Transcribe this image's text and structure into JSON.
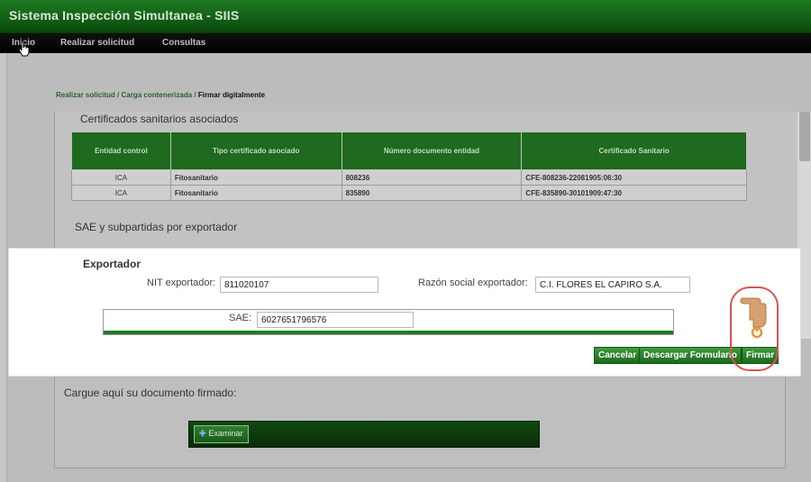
{
  "app": {
    "title": "Sistema Inspección Simultanea - SIIS"
  },
  "menu": {
    "items": [
      {
        "label": "Inicio"
      },
      {
        "label": "Realizar solicitud"
      },
      {
        "label": "Consultas"
      }
    ]
  },
  "breadcrumb": {
    "path": "Realizar solicitud / Carga contenerizada / ",
    "current": "Firmar digitalmente"
  },
  "certificates": {
    "section_title": "Certificados sanitarios asociados",
    "columns": [
      "Entidad control",
      "Tipo certificado asociado",
      "Número documento entidad",
      "Certificado Sanitario"
    ],
    "rows": [
      [
        "ICA",
        "Fitosanitario",
        "808236",
        "CFE-808236-22081905:06:30"
      ],
      [
        "ICA",
        "Fitosanitario",
        "835890",
        "CFE-835890-30101909:47:30"
      ]
    ]
  },
  "sae_section": {
    "title": "SAE y subpartidas por exportador"
  },
  "exportador": {
    "heading": "Exportador",
    "nit_label": "NIT exportador:",
    "nit_value": "811020107",
    "razon_label": "Razón social exportador:",
    "razon_value": "C.I. FLORES EL CAPIRO S.A.",
    "sae_label": "SAE:",
    "sae_value": "6027651796576"
  },
  "actions": {
    "cancel": "Cancelar",
    "download": "Descargar Formulario",
    "sign": "Firmar"
  },
  "upload": {
    "label": "Cargue aquí su documento firmado:",
    "browse": "Examinar"
  },
  "colors": {
    "brand_green": "#1f7a23",
    "highlight": "#d9534f"
  }
}
